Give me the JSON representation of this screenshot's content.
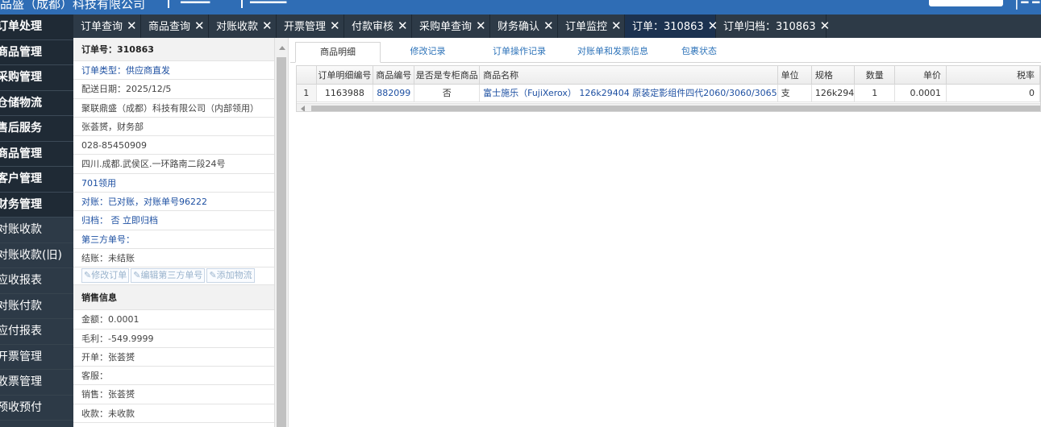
{
  "topbar": {
    "company_text": "品盛（成都）科技有限公司",
    "text2": "━━━━",
    "text3": "━━━━━",
    "right_text": "▕ ━ ━"
  },
  "sidebar": {
    "items": [
      {
        "label": "订单处理"
      },
      {
        "label": "商品管理"
      },
      {
        "label": "采购管理"
      },
      {
        "label": "仓储物流"
      },
      {
        "label": "售后服务"
      },
      {
        "label": "商品管理"
      },
      {
        "label": "客户管理"
      },
      {
        "label": "财务管理"
      },
      {
        "label": "对账收款"
      },
      {
        "label": "对账收款(旧)"
      },
      {
        "label": "应收报表"
      },
      {
        "label": "对账付款"
      },
      {
        "label": "应付报表"
      },
      {
        "label": "开票管理"
      },
      {
        "label": "收票管理"
      },
      {
        "label": "预收预付"
      }
    ]
  },
  "tabs": [
    {
      "label": "订单查询"
    },
    {
      "label": "商品查询"
    },
    {
      "label": "对账收款"
    },
    {
      "label": "开票管理"
    },
    {
      "label": "付款审核"
    },
    {
      "label": "采购单查询"
    },
    {
      "label": "财务确认"
    },
    {
      "label": "订单监控"
    },
    {
      "label": "订单：310863"
    },
    {
      "label": "订单归档：310863"
    }
  ],
  "order": {
    "header": "订单号：310863",
    "type": "订单类型：供应商直发",
    "date": "配送日期：2025/12/5",
    "company": "聚联鼎盛（成都）科技有限公司（内部领用）",
    "contact": "张荟赟，财务部",
    "phone": "028-85450909",
    "address": "四川.成都.武侯区.一环路南二段24号",
    "usage": "701领用",
    "reconcile": "对账：已对账，对账单号96222",
    "archive": "归档： 否 立即归档",
    "third_party": "第三方单号：",
    "settle": "结账：未结账",
    "btn_edit_order": "修改订单",
    "btn_edit_third": "编辑第三方单号",
    "btn_add_logistics": "添加物流"
  },
  "sales": {
    "header": "销售信息",
    "amount": "金额：0.0001",
    "profit": "毛利：-549.9999",
    "issuer": "开单：张荟赟",
    "service": "客服：",
    "sales": "销售：张荟赟",
    "payment": "收款：未收款"
  },
  "main_tabs": [
    {
      "label": "商品明细"
    },
    {
      "label": "修改记录"
    },
    {
      "label": "订单操作记录"
    },
    {
      "label": "对账单和发票信息"
    },
    {
      "label": "包裹状态"
    }
  ],
  "grid": {
    "columns": [
      "订单明细编号",
      "商品编号",
      "是否是专柜商品",
      "商品名称",
      "单位",
      "规格",
      "数量",
      "单价",
      "税率"
    ],
    "rows": [
      {
        "rownum": "1",
        "detail_id": "1163988",
        "product_id": "882099",
        "is_counter": "否",
        "name": "富士施乐（FujiXerox） 126k29404 原装定影组件四代2060/3060/3065",
        "unit": "支",
        "spec": "126k294",
        "qty": "1",
        "price": "0.0001",
        "tax": "0"
      }
    ]
  }
}
